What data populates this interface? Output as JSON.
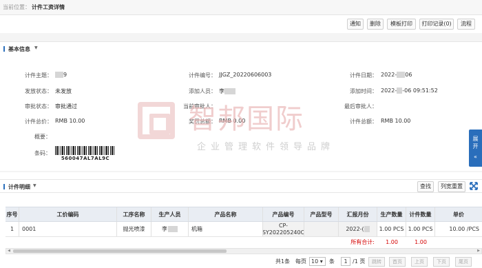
{
  "breadcrumb": {
    "prefix": "当前位置：",
    "current": "计件工资详情"
  },
  "toolbar": {
    "buttons": [
      "通知",
      "删除",
      "模板打印",
      "打印记录(0)",
      "流程"
    ]
  },
  "basic": {
    "title": "基本信息",
    "fields": {
      "subject_label": "计件主题：",
      "subject_value": "9",
      "number_label": "计件编号：",
      "number_value": "JJGZ_20220606003",
      "date_label": "计件日期：",
      "date_value_a": "2022-",
      "date_value_b": "06",
      "send_label": "发放状态：",
      "send_value": "未发放",
      "adder_label": "添加人员：",
      "adder_value": "李",
      "addtime_label": "添加时间：",
      "addtime_value_a": "2022-",
      "addtime_value_b": "-06 09:51:52",
      "approve_label": "审批状态：",
      "approve_value": "审批通过",
      "cur_approver_label": "当前审批人：",
      "cur_approver_value": "",
      "last_approver_label": "最后审批人：",
      "last_approver_value": "",
      "total_label": "计件总价：",
      "total_value": "RMB 10.00",
      "bonus_label": "奖罚总额：",
      "bonus_value": "RMB 0.00",
      "sum_label": "计件总额：",
      "sum_value": "RMB 10.00",
      "overview_label": "概要：",
      "barcode_label": "条码：",
      "barcode_value": "560047AL7AL9C"
    }
  },
  "watermark": {
    "big": "智邦国际",
    "small": "企业管理软件领导品牌"
  },
  "side_tab": {
    "chars": [
      "展",
      "开",
      "«"
    ]
  },
  "detail": {
    "title": "计件明细",
    "search_btn": "查找",
    "reset_btn": "列宽重置",
    "expand_icon": "expand-arrows-icon"
  },
  "table": {
    "headers": [
      "序号",
      "工价编码",
      "工序名称",
      "生产人员",
      "产品名称",
      "产品编号",
      "产品型号",
      "汇报月份",
      "生产数量",
      "计件数量",
      "单价"
    ],
    "row": {
      "index": "1",
      "code": "0001",
      "process": "抛光喷漆",
      "worker": "李",
      "product": "机箱",
      "product_no_1": "CP-",
      "product_no_2": "SY202205240C",
      "model": "",
      "month": "2022-(",
      "prod_qty": "1.00  PCS",
      "piece_qty": "1.00  PCS",
      "price": "10.00  /PCS"
    },
    "sum": {
      "label": "所有合计:",
      "prod_qty": "1.00",
      "piece_qty": "1.00"
    }
  },
  "pager": {
    "total": "共1条",
    "per_page": "每页",
    "per_value": "10 ▾",
    "unit": "条",
    "page_input": "1",
    "page_total": "/1 页",
    "buttons": [
      "跳转",
      "首页",
      "上页",
      "下页",
      "尾页"
    ]
  },
  "colors": {
    "accent": "#2a6ebb",
    "total_red": "#d40000",
    "header_bg": "#e9edf3"
  }
}
